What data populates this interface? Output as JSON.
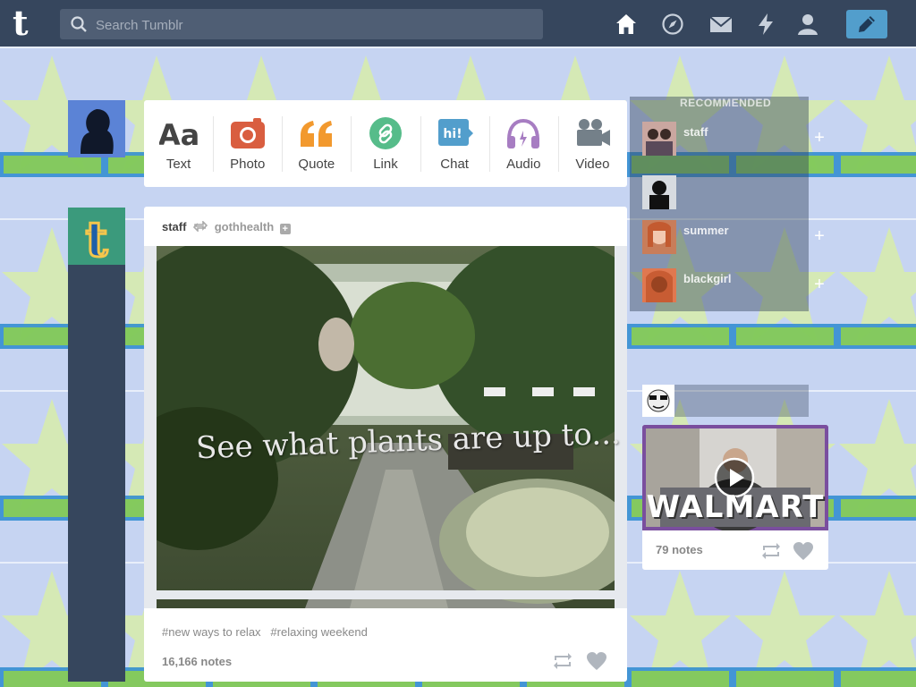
{
  "header": {
    "logo_letter": "t",
    "search_placeholder": "Search Tumblr",
    "nav_icons": [
      "home-icon",
      "compass-icon",
      "mail-icon",
      "lightning-icon",
      "user-icon"
    ],
    "compose_icon": "pencil-icon",
    "bg_color": "#36465d",
    "accent": "#529ecc"
  },
  "post_types": [
    {
      "label": "Text",
      "icon": "text-icon",
      "color": "#444444"
    },
    {
      "label": "Photo",
      "icon": "camera-icon",
      "color": "#d95e40"
    },
    {
      "label": "Quote",
      "icon": "quote-icon",
      "color": "#f2992e"
    },
    {
      "label": "Link",
      "icon": "link-icon",
      "color": "#56bc8a"
    },
    {
      "label": "Chat",
      "icon": "chat-icon",
      "color": "#529ecc"
    },
    {
      "label": "Audio",
      "icon": "headphones-icon",
      "color": "#a77dc2"
    },
    {
      "label": "Video",
      "icon": "video-camera-icon",
      "color": "#748089"
    }
  ],
  "post": {
    "author": "staff",
    "reblogged_from": "gothhealth",
    "image_caption": "See what plants are up to...",
    "tags": [
      "#new ways to relax",
      "#relaxing weekend"
    ],
    "notes": "16,166 notes"
  },
  "sidebar": {
    "heading": "RECOMMENDED",
    "blogs": [
      {
        "name": "staff",
        "sub": ""
      },
      {
        "name": "",
        "sub": ""
      },
      {
        "name": "summer",
        "sub": ""
      },
      {
        "name": "blackgirl",
        "sub": ""
      }
    ],
    "radar": {
      "video_text": "WALMART",
      "notes": "79 notes"
    }
  }
}
